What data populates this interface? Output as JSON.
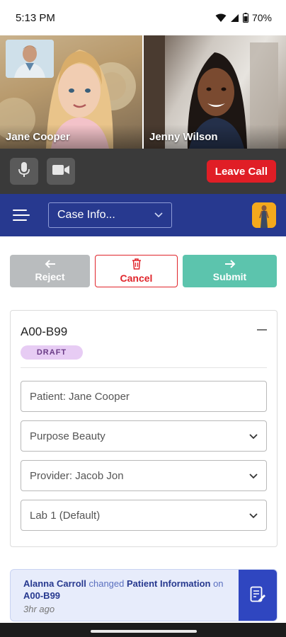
{
  "status_bar": {
    "time": "5:13 PM",
    "battery": "70%"
  },
  "video": {
    "participants": [
      {
        "name": "Jane Cooper"
      },
      {
        "name": "Jenny Wilson"
      }
    ]
  },
  "call_controls": {
    "leave_label": "Leave Call",
    "colors": {
      "leave": "#e01e26",
      "bar": "#3a3a3a"
    }
  },
  "app_bar": {
    "case_select_value": "Case Info...",
    "color": "#27398f"
  },
  "actions": {
    "reject_label": "Reject",
    "cancel_label": "Cancel",
    "submit_label": "Submit"
  },
  "case_card": {
    "case_id": "A00-B99",
    "status_badge": "DRAFT",
    "fields": [
      {
        "value": "Patient: Jane Cooper",
        "dropdown": false
      },
      {
        "value": "Purpose Beauty",
        "dropdown": true
      },
      {
        "value": "Provider: Jacob Jon",
        "dropdown": true
      },
      {
        "value": "Lab 1 (Default)",
        "dropdown": true
      }
    ]
  },
  "notification": {
    "actor": "Alanna Carroll",
    "verb": "changed",
    "object": "Patient Information",
    "prep": "on",
    "target": "A00-B99",
    "time": "3hr ago"
  }
}
